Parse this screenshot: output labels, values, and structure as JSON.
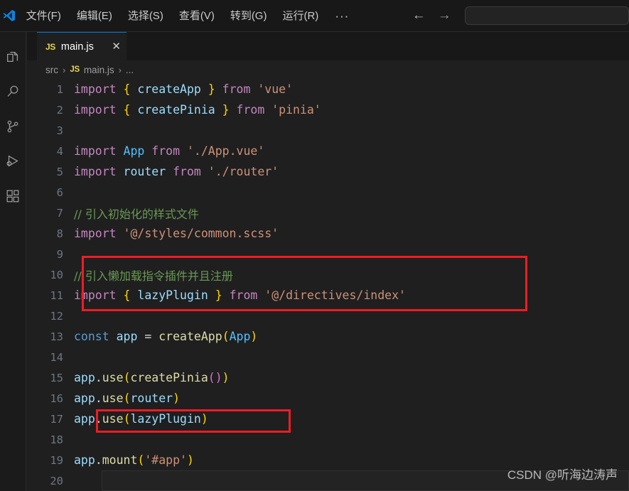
{
  "titlebar": {
    "logo_icon": "vscode-logo-icon",
    "menus": [
      {
        "label": "文件(F)"
      },
      {
        "label": "编辑(E)"
      },
      {
        "label": "选择(S)"
      },
      {
        "label": "查看(V)"
      },
      {
        "label": "转到(G)"
      },
      {
        "label": "运行(R)"
      },
      {
        "label": "···"
      }
    ],
    "nav": {
      "back_icon": "←",
      "forward_icon": "→"
    },
    "command_center_value": "",
    "command_center_placeholder": ""
  },
  "activitybar": {
    "items": [
      {
        "name": "explorer",
        "icon": "files-icon"
      },
      {
        "name": "search",
        "icon": "search-icon"
      },
      {
        "name": "source-control",
        "icon": "source-control-icon"
      },
      {
        "name": "run-and-debug",
        "icon": "run-debug-icon"
      },
      {
        "name": "extensions",
        "icon": "extensions-icon"
      }
    ]
  },
  "tab": {
    "file_type": "JS",
    "label": "main.js",
    "close_icon": "✕"
  },
  "breadcrumb": {
    "part1": "src",
    "sep1": "›",
    "file_type": "JS",
    "part2": "main.js",
    "sep2": "›",
    "part3": "..."
  },
  "editor": {
    "lines": [
      {
        "n": "1",
        "code": "import { createApp } from 'vue'"
      },
      {
        "n": "2",
        "code": "import { createPinia } from 'pinia'"
      },
      {
        "n": "3",
        "code": ""
      },
      {
        "n": "4",
        "code": "import App from './App.vue'"
      },
      {
        "n": "5",
        "code": "import router from './router'"
      },
      {
        "n": "6",
        "code": ""
      },
      {
        "n": "7",
        "code": "// 引入初始化的样式文件"
      },
      {
        "n": "8",
        "code": "import '@/styles/common.scss'"
      },
      {
        "n": "9",
        "code": ""
      },
      {
        "n": "10",
        "code": "// 引入懒加载指令插件并且注册"
      },
      {
        "n": "11",
        "code": "import { lazyPlugin } from '@/directives/index'"
      },
      {
        "n": "12",
        "code": ""
      },
      {
        "n": "13",
        "code": "const app = createApp(App)"
      },
      {
        "n": "14",
        "code": ""
      },
      {
        "n": "15",
        "code": "app.use(createPinia())"
      },
      {
        "n": "16",
        "code": "app.use(router)"
      },
      {
        "n": "17",
        "code": "app.use(lazyPlugin)"
      },
      {
        "n": "18",
        "code": ""
      },
      {
        "n": "19",
        "code": "app.mount('#app')"
      },
      {
        "n": "20",
        "code": ""
      }
    ],
    "tokens": {
      "l1": [
        [
          "t-kw",
          "import"
        ],
        [
          "t-op",
          " "
        ],
        [
          "t-brace",
          "{"
        ],
        [
          "t-op",
          " "
        ],
        [
          "t-var",
          "createApp"
        ],
        [
          "t-op",
          " "
        ],
        [
          "t-brace",
          "}"
        ],
        [
          "t-op",
          " "
        ],
        [
          "t-kw",
          "from"
        ],
        [
          "t-op",
          " "
        ],
        [
          "t-str",
          "'vue'"
        ]
      ],
      "l2": [
        [
          "t-kw",
          "import"
        ],
        [
          "t-op",
          " "
        ],
        [
          "t-brace",
          "{"
        ],
        [
          "t-op",
          " "
        ],
        [
          "t-var",
          "createPinia"
        ],
        [
          "t-op",
          " "
        ],
        [
          "t-brace",
          "}"
        ],
        [
          "t-op",
          " "
        ],
        [
          "t-kw",
          "from"
        ],
        [
          "t-op",
          " "
        ],
        [
          "t-str",
          "'pinia'"
        ]
      ],
      "l4": [
        [
          "t-kw",
          "import"
        ],
        [
          "t-op",
          " "
        ],
        [
          "t-cls",
          "App"
        ],
        [
          "t-op",
          " "
        ],
        [
          "t-kw",
          "from"
        ],
        [
          "t-op",
          " "
        ],
        [
          "t-str",
          "'./App.vue'"
        ]
      ],
      "l5": [
        [
          "t-kw",
          "import"
        ],
        [
          "t-op",
          " "
        ],
        [
          "t-var",
          "router"
        ],
        [
          "t-op",
          " "
        ],
        [
          "t-kw",
          "from"
        ],
        [
          "t-op",
          " "
        ],
        [
          "t-str",
          "'./router'"
        ]
      ],
      "l7": [
        [
          "t-cmt",
          "// 引入初始化的样式文件"
        ]
      ],
      "l8": [
        [
          "t-kw",
          "import"
        ],
        [
          "t-op",
          " "
        ],
        [
          "t-str",
          "'@/styles/common.scss'"
        ]
      ],
      "l10": [
        [
          "t-cmt",
          "// 引入懒加载指令插件并且注册"
        ]
      ],
      "l11": [
        [
          "t-kw",
          "import"
        ],
        [
          "t-op",
          " "
        ],
        [
          "t-brace",
          "{"
        ],
        [
          "t-op",
          " "
        ],
        [
          "t-var",
          "lazyPlugin"
        ],
        [
          "t-op",
          " "
        ],
        [
          "t-brace",
          "}"
        ],
        [
          "t-op",
          " "
        ],
        [
          "t-kw",
          "from"
        ],
        [
          "t-op",
          " "
        ],
        [
          "t-str",
          "'@/directives/index'"
        ]
      ],
      "l13": [
        [
          "t-decl",
          "const"
        ],
        [
          "t-op",
          " "
        ],
        [
          "t-var",
          "app"
        ],
        [
          "t-op",
          " = "
        ],
        [
          "t-fn",
          "createApp"
        ],
        [
          "t-paren1",
          "("
        ],
        [
          "t-cls",
          "App"
        ],
        [
          "t-paren1",
          ")"
        ]
      ],
      "l15": [
        [
          "t-var",
          "app"
        ],
        [
          "t-op",
          "."
        ],
        [
          "t-fn",
          "use"
        ],
        [
          "t-paren1",
          "("
        ],
        [
          "t-fn",
          "createPinia"
        ],
        [
          "t-paren2",
          "("
        ],
        [
          "t-paren2",
          ")"
        ],
        [
          "t-paren1",
          ")"
        ]
      ],
      "l16": [
        [
          "t-var",
          "app"
        ],
        [
          "t-op",
          "."
        ],
        [
          "t-fn",
          "use"
        ],
        [
          "t-paren1",
          "("
        ],
        [
          "t-var",
          "router"
        ],
        [
          "t-paren1",
          ")"
        ]
      ],
      "l17": [
        [
          "t-var",
          "app"
        ],
        [
          "t-op",
          "."
        ],
        [
          "t-fn",
          "use"
        ],
        [
          "t-paren1",
          "("
        ],
        [
          "t-var",
          "lazyPlugin"
        ],
        [
          "t-paren1",
          ")"
        ]
      ],
      "l19": [
        [
          "t-var",
          "app"
        ],
        [
          "t-op",
          "."
        ],
        [
          "t-fn",
          "mount"
        ],
        [
          "t-paren1",
          "("
        ],
        [
          "t-str",
          "'#app'"
        ],
        [
          "t-paren1",
          ")"
        ]
      ]
    }
  },
  "annotations": [
    {
      "name": "highlight-box-lazy-plugin-import",
      "color": "#ee1c25"
    },
    {
      "name": "highlight-box-lazy-plugin-use",
      "color": "#ee1c25"
    }
  ],
  "watermark": {
    "text": "CSDN @听海边涛声"
  }
}
